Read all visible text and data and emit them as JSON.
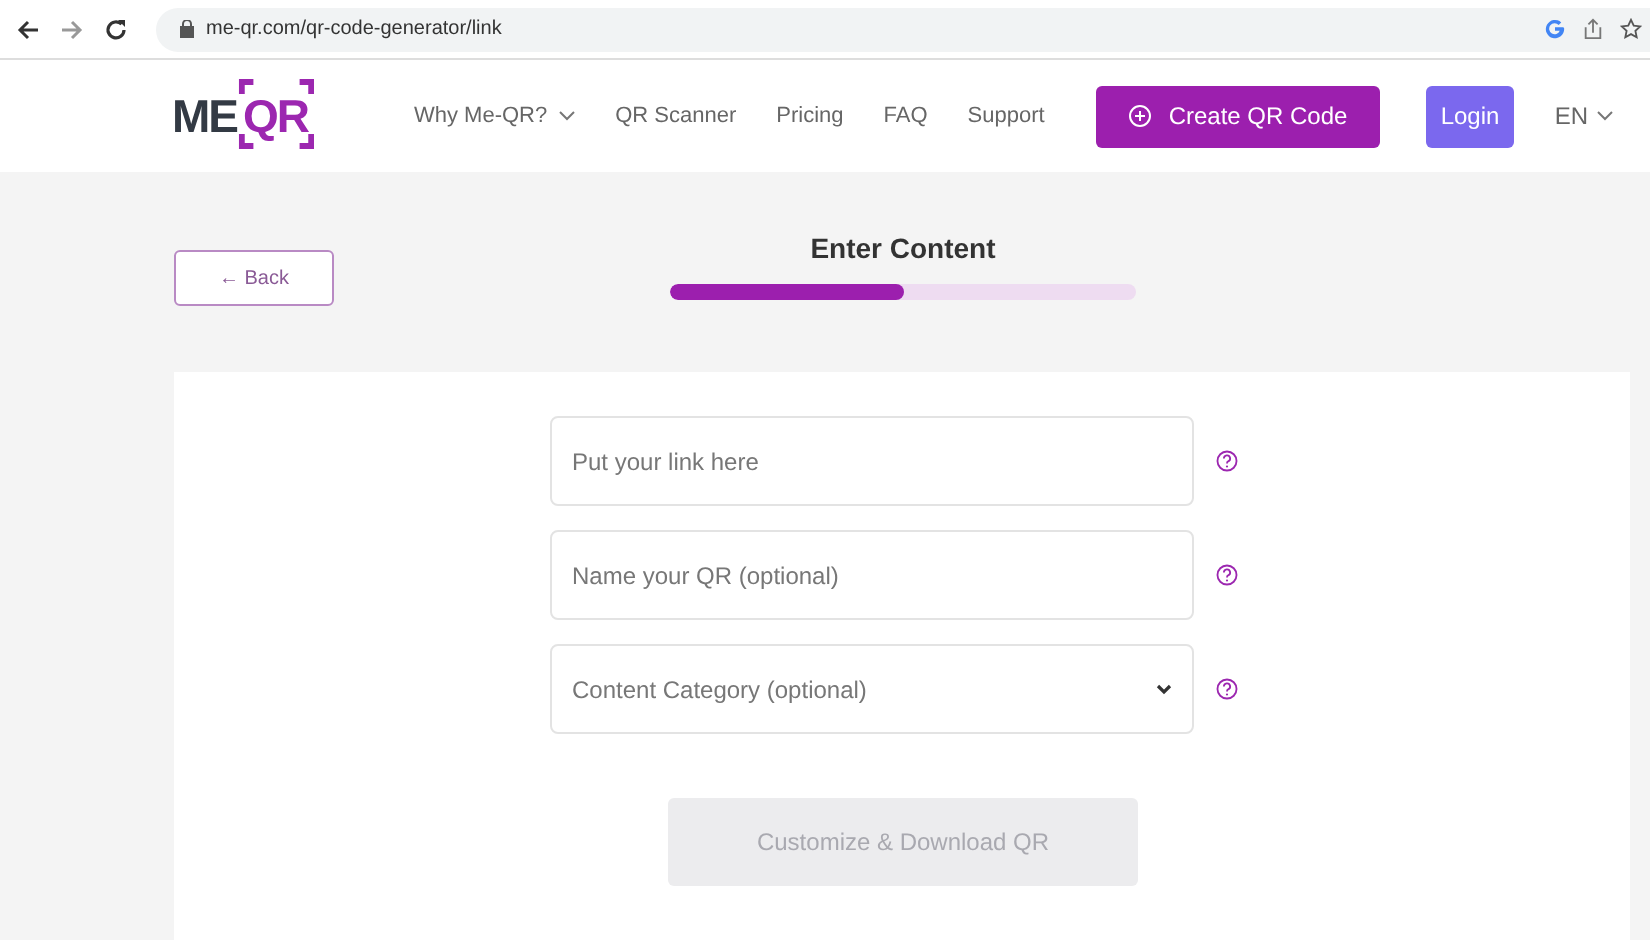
{
  "browser": {
    "url": "me-qr.com/qr-code-generator/link"
  },
  "logo": {
    "left": "ME",
    "right": "QR"
  },
  "nav": [
    {
      "label": "Why Me-QR?",
      "dropdown": true
    },
    {
      "label": "QR Scanner",
      "dropdown": false
    },
    {
      "label": "Pricing",
      "dropdown": false
    },
    {
      "label": "FAQ",
      "dropdown": false
    },
    {
      "label": "Support",
      "dropdown": false
    }
  ],
  "create_button": "Create QR Code",
  "login_button": "Login",
  "language": "EN",
  "back_button": "← Back",
  "step": {
    "title": "Enter Content",
    "level": 0.5
  },
  "fields": [
    {
      "kind": "input",
      "placeholder": "Put your link here"
    },
    {
      "kind": "input",
      "placeholder": "Name your QR (optional)"
    },
    {
      "kind": "select",
      "placeholder": "Content Category (optional)"
    }
  ],
  "submit": {
    "label": "Customize & Download QR",
    "disabled": true
  }
}
